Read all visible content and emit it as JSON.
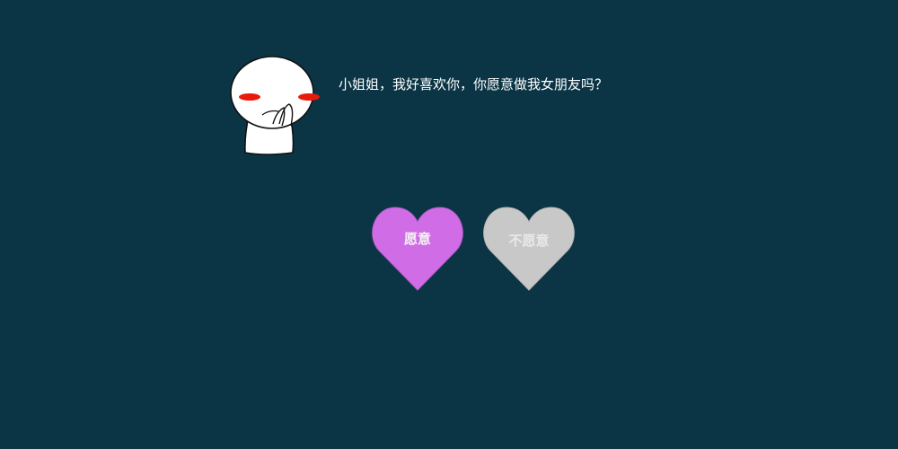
{
  "question": {
    "text": "小姐姐，我好喜欢你，你愿意做我女朋友吗？"
  },
  "buttons": {
    "yes_label": "愿意",
    "no_label": "不愿意"
  },
  "colors": {
    "background": "#0b3545",
    "yes_heart": "#d06de6",
    "no_heart": "#c8c8c8",
    "blush": "#e81a0c"
  },
  "icons": {
    "character": "shy-character-icon",
    "yes": "heart-icon",
    "no": "heart-icon"
  }
}
